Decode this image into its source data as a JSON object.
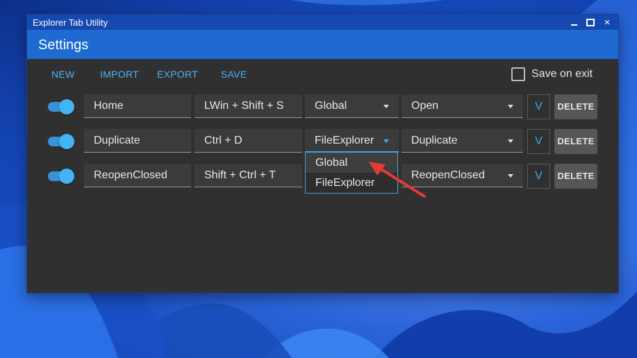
{
  "window": {
    "title": "Explorer Tab Utility",
    "page_title": "Settings",
    "controls": {
      "minimize": "minimize-icon",
      "maximize": "maximize-icon",
      "close": "×"
    }
  },
  "toolbar": {
    "new_label": "NEW",
    "import_label": "IMPORT",
    "export_label": "EXPORT",
    "save_label": "SAVE",
    "save_on_exit_label": "Save on exit",
    "save_on_exit_checked": false
  },
  "rows": [
    {
      "enabled": true,
      "name": "Home",
      "keys": "LWin + Shift + S",
      "scope": "Global",
      "action": "Open",
      "expand_label": "V",
      "delete_label": "DELETE"
    },
    {
      "enabled": true,
      "name": "Duplicate",
      "keys": "Ctrl + D",
      "scope": "FileExplorer",
      "action": "Duplicate",
      "expand_label": "V",
      "delete_label": "DELETE"
    },
    {
      "enabled": true,
      "name": "ReopenClosed",
      "keys": "Shift + Ctrl + T",
      "scope": "",
      "action": "ReopenClosed",
      "expand_label": "V",
      "delete_label": "DELETE"
    }
  ],
  "scope_dropdown": {
    "open_for_row": 1,
    "options": [
      "Global",
      "FileExplorer"
    ],
    "highlighted": "Global"
  },
  "colors": {
    "accent": "#3fa9f5",
    "titlebar": "#1549b0",
    "header": "#1e6ad0",
    "window_bg": "#303030",
    "annotation_arrow": "#e53935"
  }
}
